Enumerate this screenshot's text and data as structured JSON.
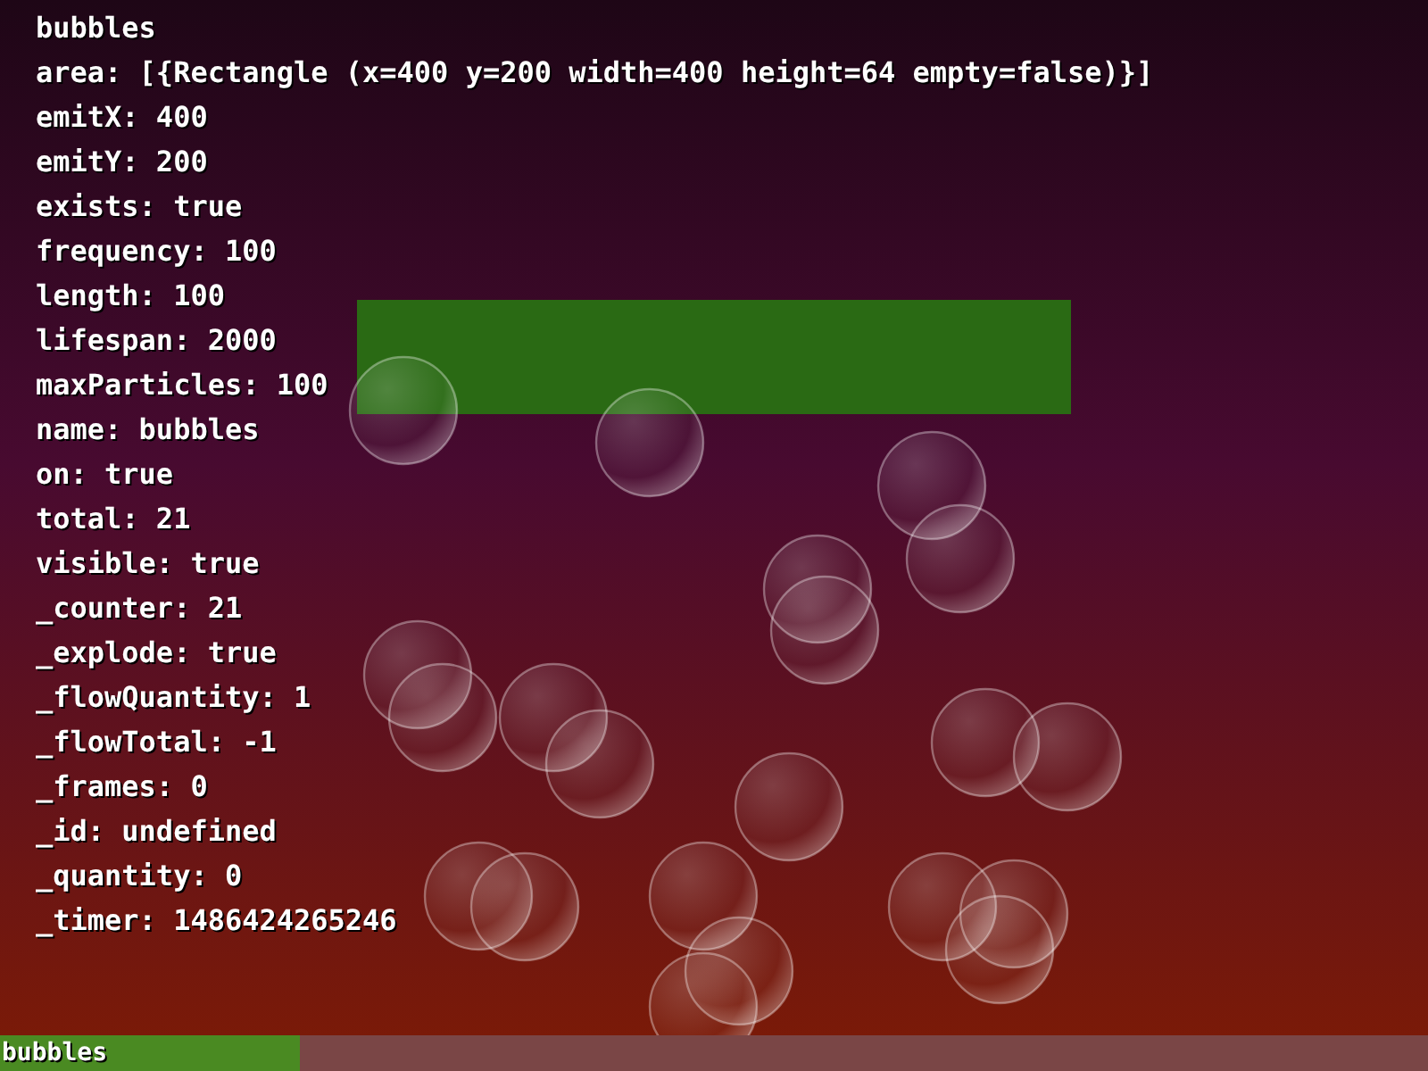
{
  "debug": {
    "title": "bubbles",
    "lines": [
      "area: [{Rectangle (x=400 y=200 width=400 height=64 empty=false)}]",
      "emitX: 400",
      "emitY: 200",
      "exists: true",
      "frequency: 100",
      "length: 100",
      "lifespan: 2000",
      "maxParticles: 100",
      "name: bubbles",
      "on: true",
      "total: 21",
      "visible: true",
      "_counter: 21",
      "_explode: true",
      "_flowQuantity: 1",
      "_flowTotal: -1",
      "_frames: 0",
      "_id: undefined",
      "_quantity: 0",
      "_timer: 1486424265246"
    ]
  },
  "status_bar": {
    "label": "bubbles",
    "level": 0.21
  }
}
